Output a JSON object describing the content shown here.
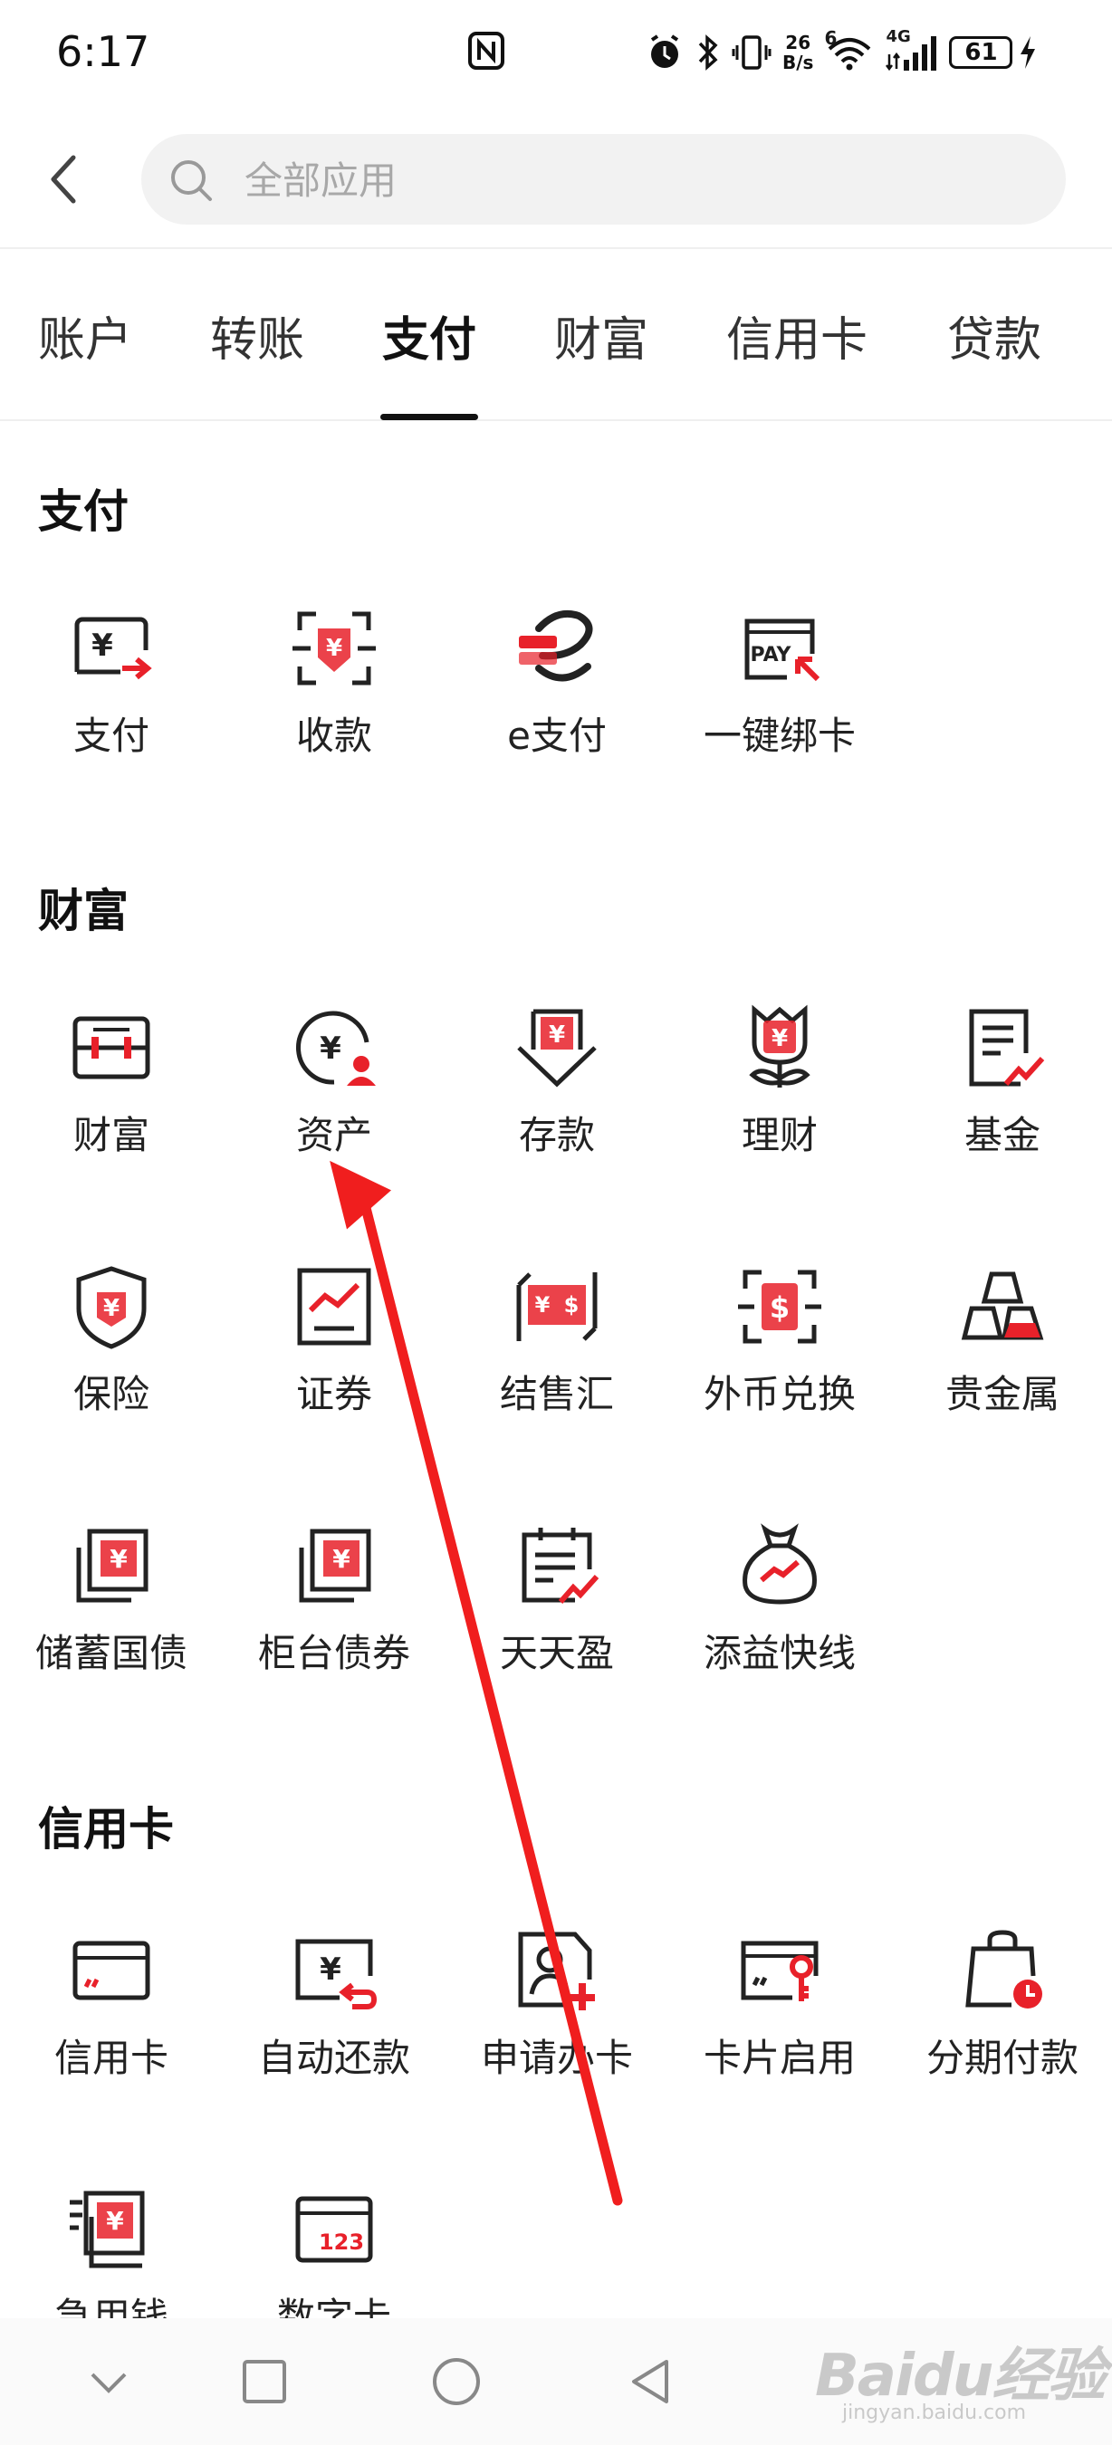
{
  "status_bar": {
    "time": "6:17",
    "net_speed_value": "26",
    "net_speed_unit": "B/s",
    "wifi_badge": "6",
    "cell_badge": "4G",
    "battery": "61"
  },
  "search": {
    "placeholder": "全部应用"
  },
  "tabs": [
    {
      "label": "账户"
    },
    {
      "label": "转账"
    },
    {
      "label": "支付",
      "active": true
    },
    {
      "label": "财富"
    },
    {
      "label": "信用卡"
    },
    {
      "label": "贷款"
    }
  ],
  "sections": {
    "payment": {
      "title": "支付",
      "items": [
        {
          "label": "支付",
          "icon": "pay-screen-icon"
        },
        {
          "label": "收款",
          "icon": "scan-receive-icon"
        },
        {
          "label": "e支付",
          "icon": "e-pay-icon"
        },
        {
          "label": "一键绑卡",
          "icon": "pay-bind-card-icon"
        }
      ]
    },
    "wealth": {
      "title": "财富",
      "items": [
        {
          "label": "财富",
          "icon": "wealth-box-icon"
        },
        {
          "label": "资产",
          "icon": "asset-yen-user-icon"
        },
        {
          "label": "存款",
          "icon": "deposit-icon"
        },
        {
          "label": "理财",
          "icon": "flower-yen-icon"
        },
        {
          "label": "基金",
          "icon": "fund-document-icon"
        },
        {
          "label": "保险",
          "icon": "shield-yen-icon"
        },
        {
          "label": "证券",
          "icon": "securities-chart-icon"
        },
        {
          "label": "结售汇",
          "icon": "exchange-settlement-icon"
        },
        {
          "label": "外币兑换",
          "icon": "dollar-scan-icon"
        },
        {
          "label": "贵金属",
          "icon": "gold-bars-icon"
        },
        {
          "label": "储蓄国债",
          "icon": "savings-bond-icon"
        },
        {
          "label": "柜台债券",
          "icon": "counter-bond-icon"
        },
        {
          "label": "天天盈",
          "icon": "calendar-growth-icon"
        },
        {
          "label": "添益快线",
          "icon": "money-bag-icon"
        }
      ]
    },
    "credit": {
      "title": "信用卡",
      "items": [
        {
          "label": "信用卡",
          "icon": "credit-card-icon"
        },
        {
          "label": "自动还款",
          "icon": "auto-repay-icon"
        },
        {
          "label": "申请办卡",
          "icon": "apply-card-icon"
        },
        {
          "label": "卡片启用",
          "icon": "card-activate-icon"
        },
        {
          "label": "分期付款",
          "icon": "installment-bag-icon"
        },
        {
          "label": "急用钱",
          "icon": "urgent-cash-icon"
        },
        {
          "label": "数字卡",
          "icon": "digital-card-icon"
        }
      ]
    }
  },
  "digital_card_number": "123",
  "watermark": {
    "brand": "Baidu经验",
    "url": "jingyan.baidu.com"
  },
  "colors": {
    "accent": "#e8212a",
    "arrow": "#f01e1e",
    "text": "#1a1a1a"
  }
}
